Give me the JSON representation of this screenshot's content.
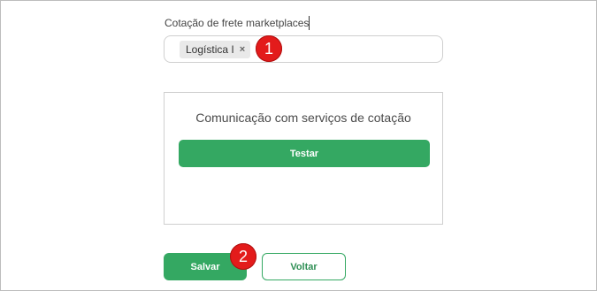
{
  "marketplaces_field": {
    "label": "Cotação de frete marketplaces",
    "tags": [
      {
        "label": "Logística I",
        "remove_icon": "×"
      }
    ]
  },
  "quote_services": {
    "title": "Comunicação com serviços de cotação",
    "test_button_label": "Testar"
  },
  "actions": {
    "save_label": "Salvar",
    "back_label": "Voltar"
  },
  "step_markers": [
    "1",
    "2"
  ],
  "colors": {
    "primary_green": "#34a862",
    "marker_red": "#e31b1b"
  }
}
